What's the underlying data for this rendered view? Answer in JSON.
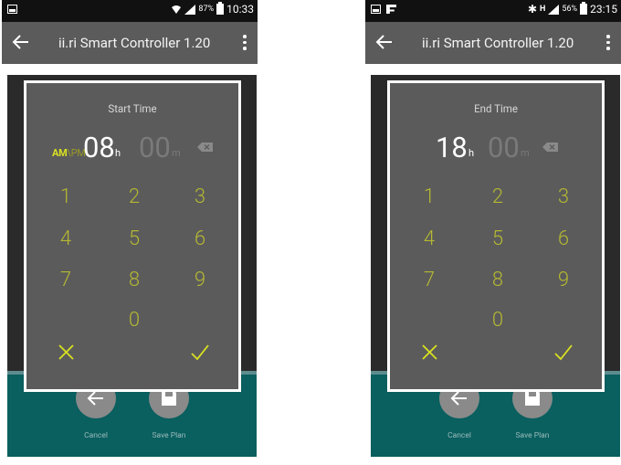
{
  "left_screen": {
    "status": {
      "battery": "87%",
      "time": "10:33"
    },
    "app_title": "ii.ri Smart Controller 1.20",
    "dialog": {
      "title": "Start Time",
      "am": "AM",
      "ampm_separator": "\\",
      "pm": "PM",
      "hours": "08",
      "hours_unit": "h",
      "minutes": "00",
      "minutes_unit": "m"
    },
    "keypad": [
      "1",
      "2",
      "3",
      "4",
      "5",
      "6",
      "7",
      "8",
      "9",
      "0"
    ],
    "cancel_label": "Cancel",
    "save_label": "Save Plan"
  },
  "right_screen": {
    "status": {
      "network": "H",
      "battery": "56%",
      "time": "23:15"
    },
    "app_title": "ii.ri Smart Controller 1.20",
    "dialog": {
      "title": "End Time",
      "hours": "18",
      "hours_unit": "h",
      "minutes": "00",
      "minutes_unit": "m"
    },
    "keypad": [
      "1",
      "2",
      "3",
      "4",
      "5",
      "6",
      "7",
      "8",
      "9",
      "0"
    ],
    "cancel_label": "Cancel",
    "save_label": "Save Plan"
  },
  "colors": {
    "app_bar": "#5b5b5b",
    "dialog": "#5b5b5b",
    "keypad_digits": "#b4b832",
    "am_active": "#d9e021",
    "teal_band": "#0a5f5f"
  },
  "icons": [
    "back-arrow-icon",
    "overflow-menu-icon",
    "backspace-icon",
    "cancel-x-icon",
    "confirm-check-icon",
    "save-disk-icon",
    "wifi-icon",
    "signal-icon",
    "battery-icon",
    "bluetooth-icon"
  ]
}
